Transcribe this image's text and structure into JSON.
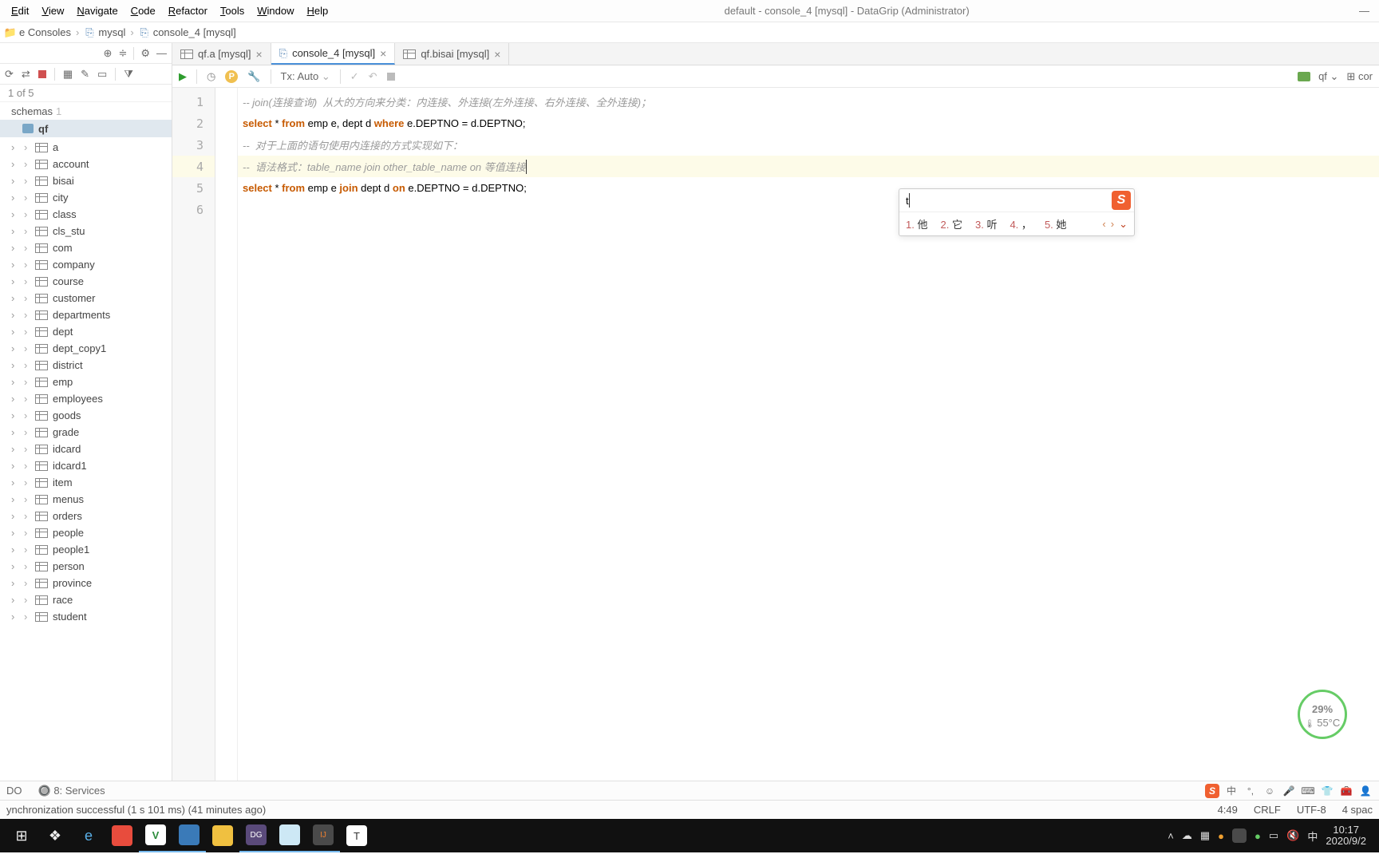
{
  "menubar": {
    "edit": "Edit",
    "view": "View",
    "navigate": "Navigate",
    "code": "Code",
    "refactor": "Refactor",
    "tools": "Tools",
    "window": "Window",
    "help": "Help"
  },
  "title": "default - console_4 [mysql] - DataGrip (Administrator)",
  "breadcrumb": {
    "consoles": "e Consoles",
    "mysql": "mysql",
    "current": "console_4 [mysql]"
  },
  "left": {
    "count": "1 of 5",
    "schemas": "schemas",
    "schemas_n": "1",
    "db": "qf",
    "tables": [
      "a",
      "account",
      "bisai",
      "city",
      "class",
      "cls_stu",
      "com",
      "company",
      "course",
      "customer",
      "departments",
      "dept",
      "dept_copy1",
      "district",
      "emp",
      "employees",
      "goods",
      "grade",
      "idcard",
      "idcard1",
      "item",
      "menus",
      "orders",
      "people",
      "people1",
      "person",
      "province",
      "race",
      "student"
    ]
  },
  "tabs": {
    "t1": "qf.a [mysql]",
    "t2": "console_4 [mysql]",
    "t3": "qf.bisai [mysql]"
  },
  "editor_tb": {
    "tx": "Tx: Auto",
    "right_qf": "qf",
    "right_cor": "cor"
  },
  "code": {
    "l1": "-- join(连接查询)  从大的方向来分类：内连接、外连接(左外连接、右外连接、全外连接)；",
    "l2_kw_select": "select",
    "l2_star": " * ",
    "l2_kw_from": "from",
    "l2_a": " emp e, dept d ",
    "l2_kw_where": "where",
    "l2_b": " e.DEPTNO = d.DEPTNO;",
    "l3": "--  对于上面的语句使用内连接的方式实现如下：",
    "l4": "--  语法格式：table_name join other_table_name on 等值连接",
    "l5_kw_select": "select",
    "l5_star": " * ",
    "l5_kw_from": "from",
    "l5_a": " emp e ",
    "l5_kw_join": "join",
    "l5_b": " dept d ",
    "l5_kw_on": "on",
    "l5_c": " e.DEPTNO = d.DEPTNO;"
  },
  "ime": {
    "input": "t",
    "c1i": "1.",
    "c1": "他",
    "c2i": "2.",
    "c2": "它",
    "c3i": "3.",
    "c3": "听",
    "c4i": "4.",
    "c4": "，",
    "c5i": "5.",
    "c5": "她"
  },
  "perf": {
    "pct": "29",
    "pct_unit": "%",
    "temp": "55°C"
  },
  "toolwin": {
    "do": "DO",
    "services": "8: Services"
  },
  "status": {
    "msg": "ynchronization successful (1 s 101 ms) (41 minutes ago)",
    "pos": "4:49",
    "crlf": "CRLF",
    "enc": "UTF-8",
    "indent": "4 spac"
  },
  "taskbar": {
    "time": "10:17",
    "date": "2020/9/2",
    "lang": "中"
  }
}
